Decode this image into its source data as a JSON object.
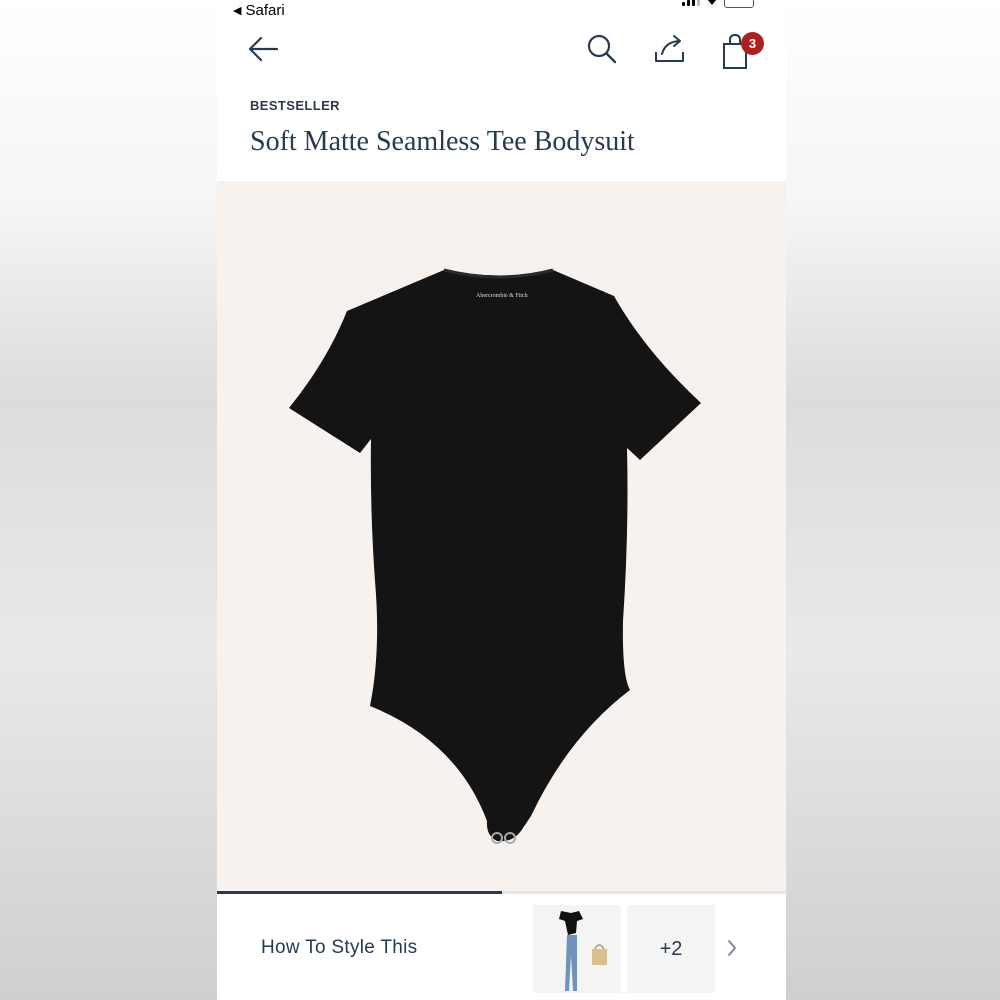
{
  "status_bar": {
    "back_app": "Safari"
  },
  "cart": {
    "count": "3"
  },
  "product": {
    "tag": "BESTSELLER",
    "title": "Soft Matte Seamless Tee Bodysuit",
    "image_progress": 0.5,
    "neck_label": "Abercrombie & Fitch"
  },
  "style_section": {
    "label": "How To Style This",
    "more_count": "+2"
  },
  "colors": {
    "navy": "#283a52",
    "badge": "#a8221f",
    "image_bg": "#f8f2ef"
  }
}
